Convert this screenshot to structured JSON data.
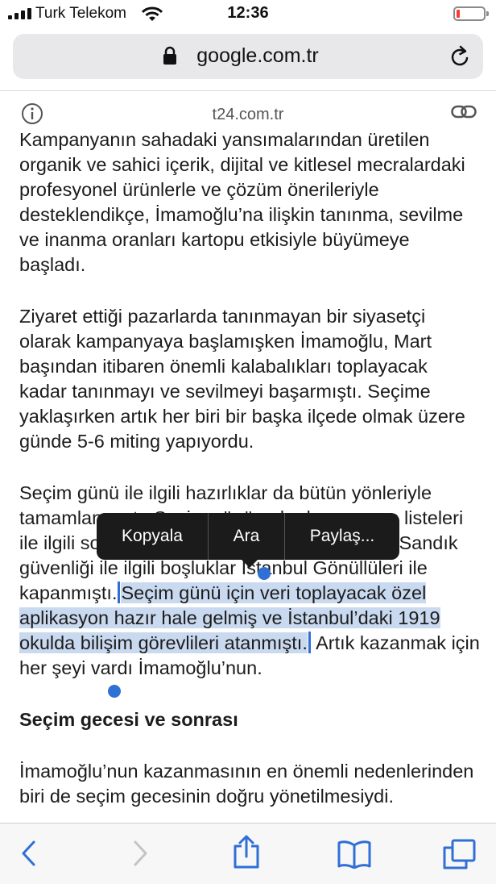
{
  "status_bar": {
    "carrier": "Turk Telekom",
    "time": "12:36",
    "battery_level": 0.08,
    "battery_color": "#ff3b30"
  },
  "address_bar": {
    "url": "google.com.tr"
  },
  "reader_header": {
    "site": "t24.com.tr"
  },
  "article": {
    "p1": "Kampanyanın sahadaki yansımalarından üretilen organik ve sahici içerik, dijital ve kitlesel mecralardaki profesyonel ürünlerle ve çözüm önerileriyle desteklendikçe, İmamoğlu’na ilişkin tanınma, sevilme ve inanma oranları kartopu etkisiyle büyümeye başladı.",
    "p2": "Ziyaret ettiği pazarlarda tanınmayan bir siyasetçi olarak kampanyaya başlamışken İmamoğlu, Mart başından itibaren önemli kalabalıkları toplayacak kadar tanınmayı ve sevilmeyi başarmıştı. Seçime yaklaşırken artık her biri bir başka ilçede olmak üzere günde 5-6 miting yapıyordu.",
    "p3_before": "Seçim günü ile ilgili hazırlıklar da bütün yönleriyle tamamlanmıştı. Seçim gününe kadar seçmen listeleri ile ilgili sorunlar çözülmüş ve tamamlanmıştı. Sandık güvenliği ile ilgili boşluklar İstanbul Gönüllüleri ile kapanmıştı.",
    "p3_selected": "Seçim günü için veri toplayacak özel aplikasyon hazır hale gelmiş ve İstanbul’daki 1919 okulda bilişim görevlileri atanmıştı.",
    "p3_after": "Artık kazanmak için her şeyi vardı İmamoğlu’nun.",
    "heading": "Seçim gecesi ve sonrası",
    "p4": "İmamoğlu’nun kazanmasının en önemli nedenlerinden biri de seçim gecesinin doğru yönetilmesiydi."
  },
  "context_menu": {
    "copy": "Kopyala",
    "lookup": "Ara",
    "share": "Paylaş..."
  },
  "colors": {
    "selection": "#c9d9ef",
    "handle": "#2f6fd6",
    "toolbar_icon": "#2f6fd6"
  }
}
